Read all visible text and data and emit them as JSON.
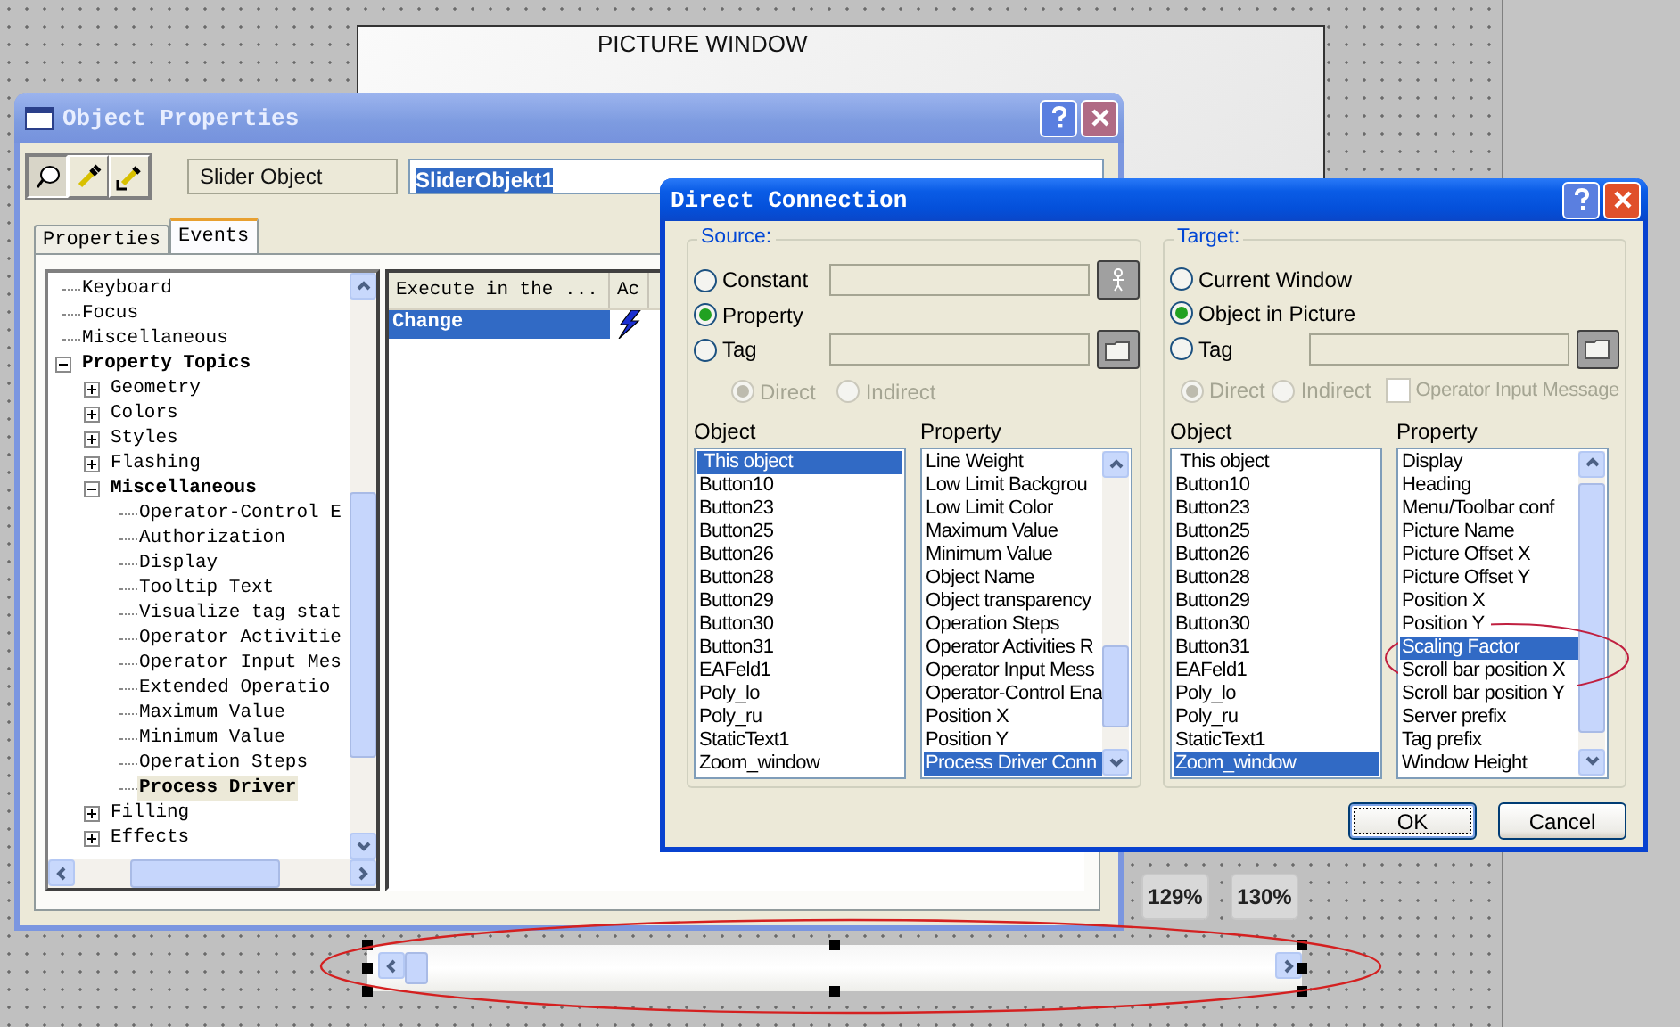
{
  "picture_window": {
    "title": "PICTURE WINDOW"
  },
  "object_properties": {
    "title": "Object Properties",
    "toolbar_buttons": [
      {
        "kind": "pin",
        "pressed": true
      },
      {
        "kind": "pick",
        "pressed": false
      },
      {
        "kind": "pick-arrow",
        "pressed": false
      }
    ],
    "object_type": "Slider Object",
    "object_name": "SliderObjekt1",
    "tabs": [
      {
        "label": "Properties",
        "selected": false
      },
      {
        "label": "Events",
        "selected": true
      }
    ],
    "tree": [
      {
        "label": "Keyboard",
        "bold": false,
        "selected": false
      },
      {
        "label": "Focus",
        "bold": false,
        "selected": false
      },
      {
        "label": "Miscellaneous",
        "bold": false,
        "selected": false
      },
      {
        "label": "Property Topics",
        "bold": true,
        "selected": false,
        "expanded": true,
        "children": [
          {
            "label": "Geometry",
            "bold": false,
            "selected": false,
            "expanded": false
          },
          {
            "label": "Colors",
            "bold": false,
            "selected": false,
            "expanded": false
          },
          {
            "label": "Styles",
            "bold": false,
            "selected": false,
            "expanded": false
          },
          {
            "label": "Flashing",
            "bold": false,
            "selected": false,
            "expanded": false
          },
          {
            "label": "Miscellaneous",
            "bold": true,
            "selected": false,
            "expanded": true,
            "children": [
              {
                "label": "Operator-Control E",
                "bold": false,
                "selected": false
              },
              {
                "label": "Authorization",
                "bold": false,
                "selected": false
              },
              {
                "label": "Display",
                "bold": false,
                "selected": false
              },
              {
                "label": "Tooltip Text",
                "bold": false,
                "selected": false
              },
              {
                "label": "Visualize tag stat",
                "bold": false,
                "selected": false
              },
              {
                "label": "Operator Activitie",
                "bold": false,
                "selected": false
              },
              {
                "label": "Operator Input Mes",
                "bold": false,
                "selected": false
              },
              {
                "label": "Extended Operatio",
                "bold": false,
                "selected": false
              },
              {
                "label": "Maximum Value",
                "bold": false,
                "selected": false
              },
              {
                "label": "Minimum Value",
                "bold": false,
                "selected": false
              },
              {
                "label": "Operation Steps",
                "bold": false,
                "selected": false
              },
              {
                "label": "Process Driver",
                "bold": true,
                "selected": true
              }
            ]
          },
          {
            "label": "Filling",
            "bold": false,
            "selected": false,
            "expanded": false
          },
          {
            "label": "Effects",
            "bold": false,
            "selected": false,
            "expanded": false
          }
        ]
      }
    ],
    "table": {
      "columns": [
        "Execute in the ...",
        "Ac"
      ],
      "rows": [
        {
          "event": "Change",
          "selected": true,
          "has_action": true
        }
      ]
    }
  },
  "direct_connection": {
    "title": "Direct Connection",
    "source": {
      "label": "Source:",
      "options": [
        {
          "kind": "constant",
          "label": "Constant",
          "selected": false
        },
        {
          "kind": "property",
          "label": "Property",
          "selected": true
        },
        {
          "kind": "tag",
          "label": "Tag",
          "selected": false
        }
      ],
      "modes": [
        {
          "label": "Direct",
          "selected": true,
          "disabled": true
        },
        {
          "label": "Indirect",
          "selected": false,
          "disabled": true
        }
      ],
      "object_label": "Object",
      "objects": [
        {
          "text": " This object",
          "selected": true
        },
        {
          "text": "Button10",
          "selected": false
        },
        {
          "text": "Button23",
          "selected": false
        },
        {
          "text": "Button25",
          "selected": false
        },
        {
          "text": "Button26",
          "selected": false
        },
        {
          "text": "Button28",
          "selected": false
        },
        {
          "text": "Button29",
          "selected": false
        },
        {
          "text": "Button30",
          "selected": false
        },
        {
          "text": "Button31",
          "selected": false
        },
        {
          "text": "EAFeld1",
          "selected": false
        },
        {
          "text": "Poly_lo",
          "selected": false
        },
        {
          "text": "Poly_ru",
          "selected": false
        },
        {
          "text": "StaticText1",
          "selected": false
        },
        {
          "text": "Zoom_window",
          "selected": false
        }
      ],
      "property_label": "Property",
      "properties": [
        {
          "text": "Line Weight",
          "selected": false
        },
        {
          "text": "Low Limit Backgrou",
          "selected": false
        },
        {
          "text": "Low Limit Color",
          "selected": false
        },
        {
          "text": "Maximum Value",
          "selected": false
        },
        {
          "text": "Minimum Value",
          "selected": false
        },
        {
          "text": "Object Name",
          "selected": false
        },
        {
          "text": "Object transparency",
          "selected": false
        },
        {
          "text": "Operation Steps",
          "selected": false
        },
        {
          "text": "Operator Activities R",
          "selected": false
        },
        {
          "text": "Operator Input Mess",
          "selected": false
        },
        {
          "text": "Operator-Control Ena",
          "selected": false
        },
        {
          "text": "Position X",
          "selected": false
        },
        {
          "text": "Position Y",
          "selected": false
        },
        {
          "text": "Process Driver Conn",
          "selected": true
        }
      ]
    },
    "target": {
      "label": "Target:",
      "options": [
        {
          "kind": "window",
          "label": "Current Window",
          "selected": false
        },
        {
          "kind": "object",
          "label": "Object in Picture",
          "selected": true
        },
        {
          "kind": "tag",
          "label": "Tag",
          "selected": false
        }
      ],
      "modes": [
        {
          "label": "Direct",
          "selected": true,
          "disabled": true
        },
        {
          "label": "Indirect",
          "selected": false,
          "disabled": true
        }
      ],
      "operator_input_message": {
        "label": "Operator Input Message",
        "checked": false,
        "disabled": true
      },
      "object_label": "Object",
      "objects": [
        {
          "text": " This object",
          "selected": false
        },
        {
          "text": "Button10",
          "selected": false
        },
        {
          "text": "Button23",
          "selected": false
        },
        {
          "text": "Button25",
          "selected": false
        },
        {
          "text": "Button26",
          "selected": false
        },
        {
          "text": "Button28",
          "selected": false
        },
        {
          "text": "Button29",
          "selected": false
        },
        {
          "text": "Button30",
          "selected": false
        },
        {
          "text": "Button31",
          "selected": false
        },
        {
          "text": "EAFeld1",
          "selected": false
        },
        {
          "text": "Poly_lo",
          "selected": false
        },
        {
          "text": "Poly_ru",
          "selected": false
        },
        {
          "text": "StaticText1",
          "selected": false
        },
        {
          "text": "Zoom_window",
          "selected": true
        }
      ],
      "property_label": "Property",
      "properties": [
        {
          "text": "Display",
          "selected": false
        },
        {
          "text": "Heading",
          "selected": false
        },
        {
          "text": "Menu/Toolbar conf",
          "selected": false
        },
        {
          "text": "Picture Name",
          "selected": false
        },
        {
          "text": "Picture Offset X",
          "selected": false
        },
        {
          "text": "Picture Offset Y",
          "selected": false
        },
        {
          "text": "Position X",
          "selected": false
        },
        {
          "text": "Position Y",
          "selected": false
        },
        {
          "text": "Scaling Factor",
          "selected": true
        },
        {
          "text": "Scroll bar position X",
          "selected": false
        },
        {
          "text": "Scroll bar position Y",
          "selected": false
        },
        {
          "text": "Server prefix",
          "selected": false
        },
        {
          "text": "Tag prefix",
          "selected": false
        },
        {
          "text": "Window Height",
          "selected": false
        }
      ]
    },
    "buttons": [
      {
        "label": "OK",
        "default": true
      },
      {
        "label": "Cancel",
        "default": false
      }
    ]
  },
  "zoom_buttons": [
    "129%",
    "130%"
  ],
  "slider": {
    "level": 0
  }
}
